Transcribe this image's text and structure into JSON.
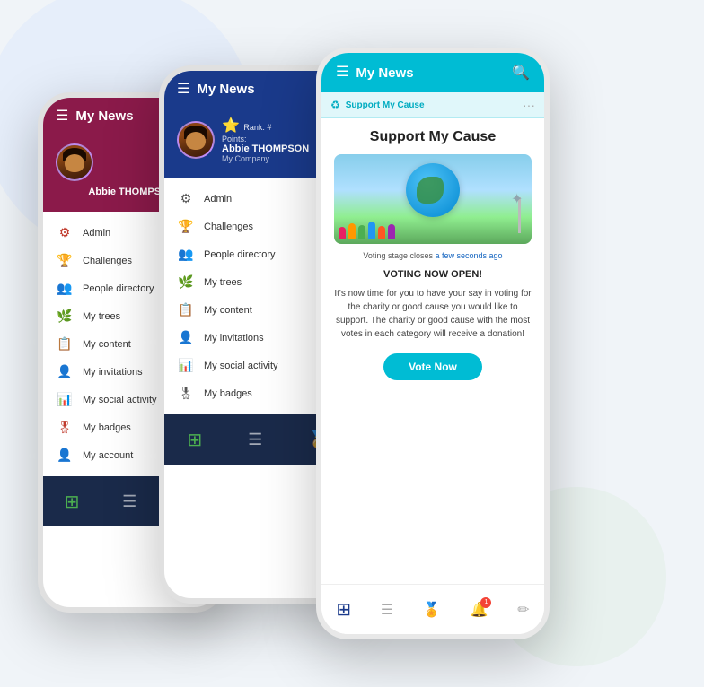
{
  "app": {
    "title": "My News",
    "search_icon": "🔍",
    "menu_icon": "☰"
  },
  "phone1": {
    "header": {
      "title": "My News",
      "bg": "#8b1a4a"
    },
    "profile": {
      "name": "Abbie THOMPSON",
      "rank_label": "Rank:",
      "points_label": "Points:"
    },
    "menu": [
      {
        "icon": "⚙",
        "label": "Admin"
      },
      {
        "icon": "🏆",
        "label": "Challenges"
      },
      {
        "icon": "👥",
        "label": "People directory"
      },
      {
        "icon": "🌿",
        "label": "My trees"
      },
      {
        "icon": "📋",
        "label": "My content"
      },
      {
        "icon": "👤",
        "label": "My invitations"
      },
      {
        "icon": "📊",
        "label": "My social activity"
      },
      {
        "icon": "🎖",
        "label": "My badges"
      },
      {
        "icon": "👤",
        "label": "My account"
      }
    ]
  },
  "phone2": {
    "header": {
      "title": "My News",
      "bg": "#1a3a8b"
    },
    "profile": {
      "name": "Abbie THOMPSON",
      "company": "My Company",
      "rank_label": "Rank: #",
      "points_label": "Points:"
    },
    "menu": [
      {
        "icon": "⚙",
        "label": "Admin"
      },
      {
        "icon": "🏆",
        "label": "Challenges"
      },
      {
        "icon": "👥",
        "label": "People directory"
      },
      {
        "icon": "🌿",
        "label": "My trees"
      },
      {
        "icon": "📋",
        "label": "My content"
      },
      {
        "icon": "👤",
        "label": "My invitations"
      },
      {
        "icon": "📊",
        "label": "My social activity"
      },
      {
        "icon": "🎖",
        "label": "My badges"
      }
    ]
  },
  "phone3": {
    "header": {
      "title": "My News",
      "bg": "#00bcd4"
    },
    "card": {
      "header_label": "Support My Cause",
      "main_title": "Support My Cause",
      "voting_closes": "Voting stage closes",
      "voting_closes_link": "a few seconds ago",
      "voting_open": "VOTING NOW OPEN!",
      "description": "It's now time for you to have your say in voting for the charity or good cause you would like to support. The charity or good cause with the most votes in each category will receive a donation!",
      "vote_button": "Vote Now"
    },
    "bottom_nav": {
      "badge_count": "1"
    }
  }
}
